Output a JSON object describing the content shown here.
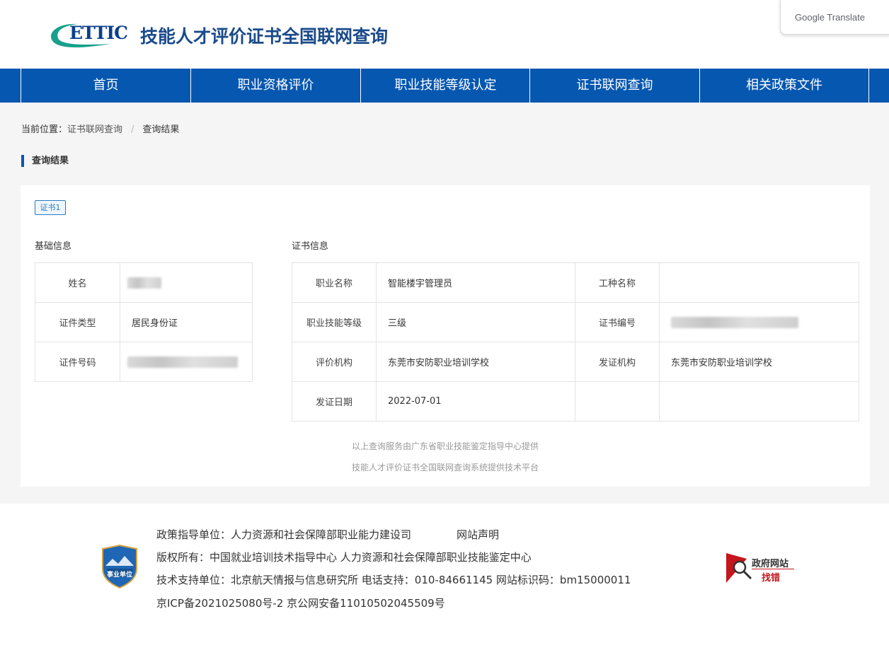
{
  "header": {
    "logo_text": "ETTIC",
    "site_title": "技能人才评价证书全国联网查询",
    "translate_widget": "Google Translate"
  },
  "nav": [
    {
      "label": "首页"
    },
    {
      "label": "职业资格评价"
    },
    {
      "label": "职业技能等级认定"
    },
    {
      "label": "证书联网查询"
    },
    {
      "label": "相关政策文件"
    }
  ],
  "breadcrumb": {
    "prefix": "当前位置：",
    "items": [
      "证书联网查询",
      "查询结果"
    ],
    "separator": "/"
  },
  "section_title": "查询结果",
  "card": {
    "tag": "证书1",
    "basic": {
      "title": "基础信息",
      "rows": [
        {
          "label": "姓名",
          "value": ""
        },
        {
          "label": "证件类型",
          "value": "居民身份证"
        },
        {
          "label": "证件号码",
          "value": ""
        }
      ]
    },
    "cert": {
      "title": "证书信息",
      "rows": [
        {
          "l1": "职业名称",
          "v1": "智能楼宇管理员",
          "l2": "工种名称",
          "v2": ""
        },
        {
          "l1": "职业技能等级",
          "v1": "三级",
          "l2": "证书编号",
          "v2": ""
        },
        {
          "l1": "评价机构",
          "v1": "东莞市安防职业培训学校",
          "l2": "发证机构",
          "v2": "东莞市安防职业培训学校"
        },
        {
          "l1": "发证日期",
          "v1": "2022-07-01",
          "l2": "",
          "v2": ""
        }
      ]
    },
    "notes": [
      "以上查询服务由广东省职业技能鉴定指导中心提供",
      "技能人才评价证书全国联网查询系统提供技术平台"
    ]
  },
  "footer": {
    "line1": "政策指导单位：人力资源和社会保障部职业能力建设司",
    "statement_link": "网站声明",
    "line2": "版权所有：中国就业培训技术指导中心   人力资源和社会保障部职业技能鉴定中心",
    "line3": "技术支持单位：北京航天情报与信息研究所   电话支持：010-84661145   网站标识码：bm15000011",
    "line4": "京ICP备2021025080号-2   京公网安备11010502045509号",
    "badge_text": "事业单位",
    "zhaocuo_line1": "政府网站",
    "zhaocuo_line2": "找错"
  },
  "colors": {
    "nav_bg": "#0657b0",
    "title": "#1a4a8a",
    "logo_teal": "#17a08c",
    "accent_red": "#c4161c"
  }
}
